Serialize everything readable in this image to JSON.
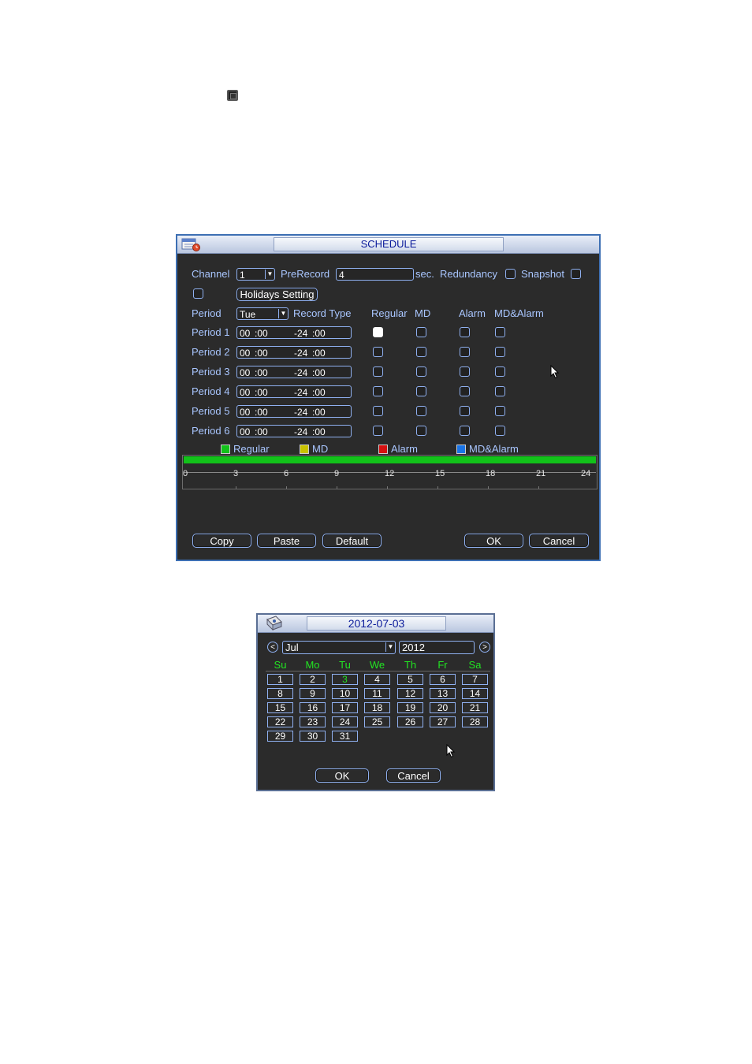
{
  "schedule": {
    "title": "SCHEDULE",
    "channel_label": "Channel",
    "channel_value": "1",
    "prerecord_label": "PreRecord",
    "prerecord_value": "4",
    "sec_label": "sec.",
    "redundancy_label": "Redundancy",
    "snapshot_label": "Snapshot",
    "holidays_button": "Holidays Setting",
    "period_label": "Period",
    "period_value": "Tue",
    "record_type_label": "Record Type",
    "col_regular": "Regular",
    "col_md": "MD",
    "col_alarm": "Alarm",
    "col_md_alarm": "MD&Alarm",
    "periods": [
      {
        "label": "Period 1",
        "start_h": "00",
        "start_m": ":00",
        "end_h": "-24",
        "end_m": ":00",
        "regular": true
      },
      {
        "label": "Period 2",
        "start_h": "00",
        "start_m": ":00",
        "end_h": "-24",
        "end_m": ":00",
        "regular": false
      },
      {
        "label": "Period 3",
        "start_h": "00",
        "start_m": ":00",
        "end_h": "-24",
        "end_m": ":00",
        "regular": false
      },
      {
        "label": "Period 4",
        "start_h": "00",
        "start_m": ":00",
        "end_h": "-24",
        "end_m": ":00",
        "regular": false
      },
      {
        "label": "Period 5",
        "start_h": "00",
        "start_m": ":00",
        "end_h": "-24",
        "end_m": ":00",
        "regular": false
      },
      {
        "label": "Period 6",
        "start_h": "00",
        "start_m": ":00",
        "end_h": "-24",
        "end_m": ":00",
        "regular": false
      }
    ],
    "legend": [
      {
        "label": "Regular",
        "color": "#12c21a"
      },
      {
        "label": "MD",
        "color": "#c9c200"
      },
      {
        "label": "Alarm",
        "color": "#d61010"
      },
      {
        "label": "MD&Alarm",
        "color": "#1a74e6"
      }
    ],
    "timeline_ticks": [
      "0",
      "3",
      "6",
      "9",
      "12",
      "15",
      "18",
      "21",
      "24"
    ],
    "buttons": {
      "copy": "Copy",
      "paste": "Paste",
      "default": "Default",
      "ok": "OK",
      "cancel": "Cancel"
    }
  },
  "calendar": {
    "title": "2012-07-03",
    "prev": "<",
    "next": ">",
    "month": "Jul",
    "year": "2012",
    "weekdays": [
      "Su",
      "Mo",
      "Tu",
      "We",
      "Th",
      "Fr",
      "Sa"
    ],
    "today": "3",
    "weeks": [
      [
        "1",
        "2",
        "3",
        "4",
        "5",
        "6",
        "7"
      ],
      [
        "8",
        "9",
        "10",
        "11",
        "12",
        "13",
        "14"
      ],
      [
        "15",
        "16",
        "17",
        "18",
        "19",
        "20",
        "21"
      ],
      [
        "22",
        "23",
        "24",
        "25",
        "26",
        "27",
        "28"
      ],
      [
        "29",
        "30",
        "31",
        "",
        "",
        "",
        ""
      ]
    ],
    "ok": "OK",
    "cancel": "Cancel"
  },
  "colors": {
    "accent_border": "#3d6fb3",
    "label_blue": "#a9c6ff",
    "highlight_green": "#22e522"
  }
}
